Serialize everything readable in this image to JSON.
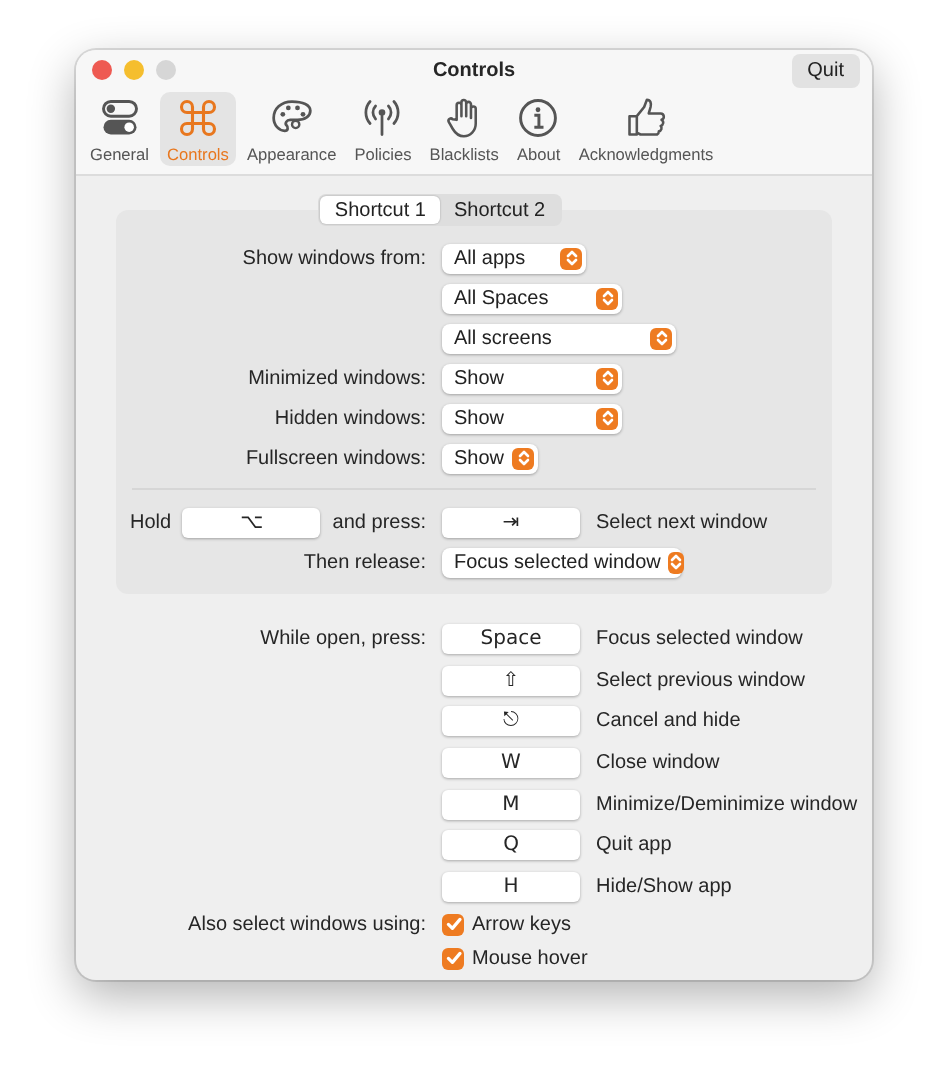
{
  "window": {
    "title": "Controls"
  },
  "quit_button": "Quit",
  "toolbar": [
    {
      "label": "General",
      "selected": false
    },
    {
      "label": "Controls",
      "selected": true
    },
    {
      "label": "Appearance",
      "selected": false
    },
    {
      "label": "Policies",
      "selected": false
    },
    {
      "label": "Blacklists",
      "selected": false
    },
    {
      "label": "About",
      "selected": false
    },
    {
      "label": "Acknowledgments",
      "selected": false
    }
  ],
  "segments": [
    {
      "label": "Shortcut 1",
      "selected": true
    },
    {
      "label": "Shortcut 2",
      "selected": false
    }
  ],
  "settings": [
    {
      "label": "Show windows from:",
      "popups": [
        "All apps",
        "All Spaces",
        "All screens"
      ]
    },
    {
      "label": "Minimized windows:",
      "popups": [
        "Show"
      ]
    },
    {
      "label": "Hidden windows:",
      "popups": [
        "Show"
      ]
    },
    {
      "label": "Fullscreen windows:",
      "popups": [
        "Show"
      ]
    }
  ],
  "hold": {
    "label": "Hold",
    "key": "⌥",
    "press_label": "and press:",
    "press_key": "⇥",
    "action": "Select next window"
  },
  "release": {
    "label": "Then release:",
    "popup": "Focus selected window"
  },
  "while_open": {
    "label": "While open, press:",
    "shortcuts": [
      {
        "key": "Space",
        "action": "Focus selected window"
      },
      {
        "key": "⇧",
        "action": "Select previous window"
      },
      {
        "key": "⎋",
        "action": "Cancel and hide"
      },
      {
        "key": "W",
        "action": "Close window"
      },
      {
        "key": "M",
        "action": "Minimize/Deminimize window"
      },
      {
        "key": "Q",
        "action": "Quit app"
      },
      {
        "key": "H",
        "action": "Hide/Show app"
      }
    ]
  },
  "also_select": {
    "label": "Also select windows using:",
    "items": [
      {
        "label": "Arrow keys",
        "checked": true
      },
      {
        "label": "Mouse hover",
        "checked": true
      }
    ]
  }
}
